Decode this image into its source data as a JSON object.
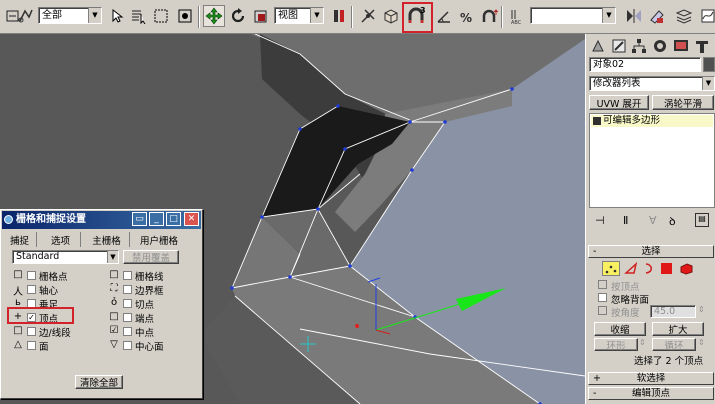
{
  "toolbar": {
    "selection_set": "全部",
    "reference_coord": "视图",
    "named_selection": "",
    "items": [
      {
        "name": "undo-icon"
      },
      {
        "name": "link-icon"
      },
      {
        "name": "select-icon"
      },
      {
        "name": "select-by-name-icon"
      },
      {
        "name": "rect-region-icon"
      },
      {
        "name": "window-crossing-icon"
      },
      {
        "name": "move-icon"
      },
      {
        "name": "rotate-icon"
      },
      {
        "name": "scale-icon"
      },
      {
        "name": "pivot-icon"
      },
      {
        "name": "manipulate-icon"
      },
      {
        "name": "keyboard-shortcut-icon"
      },
      {
        "name": "snap-3d-icon"
      },
      {
        "name": "angle-snap-icon"
      },
      {
        "name": "percent-snap-icon"
      },
      {
        "name": "spinner-snap-icon"
      },
      {
        "name": "named-selection-icon"
      },
      {
        "name": "mirror-icon"
      },
      {
        "name": "align-icon"
      },
      {
        "name": "layer-icon"
      },
      {
        "name": "curve-editor-icon"
      }
    ],
    "snap_button_label": "3",
    "highlight_color": "#d2232a"
  },
  "viewport": {
    "background": "#585858",
    "face_color": "#8a93a6",
    "edge_color": "#ffffff",
    "vertex_color": "#1f3ad6",
    "gizmo_color": "#19e619"
  },
  "command_panel": {
    "object_name": "对象02",
    "modifier_list": "修改器列表",
    "buttons": {
      "uvw_unwrap": "UVW 展开",
      "turbosmooth": "涡轮平滑"
    },
    "stack_item": "可编辑多边形",
    "selection_rollout": {
      "title": "选择",
      "by_vertex": "按顶点",
      "ignore_backfacing": "忽略背面",
      "by_angle": "按角度",
      "angle_value": "45.0",
      "shrink": "收缩",
      "grow": "扩大",
      "ring": "环形",
      "loop": "循环",
      "status": "选择了 2 个顶点"
    },
    "soft_selection_rollout": "软选择",
    "edit_vertices_rollout": "编辑顶点"
  },
  "dialog": {
    "title": "栅格和捕捉设置",
    "tabs": [
      "捕捉",
      "选项",
      "主栅格",
      "用户栅格"
    ],
    "preset": "Standard",
    "disable_all": "禁用覆盖",
    "clear_all": "清除全部",
    "snaps_left": [
      {
        "icon": "□",
        "label": "栅格点",
        "checked": false
      },
      {
        "icon": "人",
        "label": "轴心",
        "checked": false
      },
      {
        "icon": "ь",
        "label": "垂足",
        "checked": false
      },
      {
        "icon": "+",
        "label": "顶点",
        "checked": true
      },
      {
        "icon": "□",
        "label": "边/线段",
        "checked": false
      },
      {
        "icon": "△",
        "label": "面",
        "checked": false
      }
    ],
    "snaps_right": [
      {
        "icon": "□",
        "label": "栅格线",
        "checked": false
      },
      {
        "icon": "⛶",
        "label": "边界框",
        "checked": false
      },
      {
        "icon": "ỏ",
        "label": "切点",
        "checked": false
      },
      {
        "icon": "□",
        "label": "端点",
        "checked": false
      },
      {
        "icon": "☑",
        "label": "中点",
        "checked": false
      },
      {
        "icon": "▽",
        "label": "中心面",
        "checked": false
      }
    ]
  }
}
